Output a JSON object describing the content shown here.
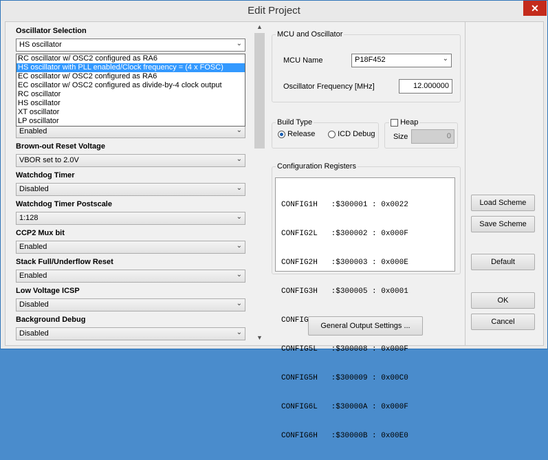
{
  "window": {
    "title": "Edit Project",
    "close_glyph": "✕"
  },
  "left": {
    "oscillator": {
      "label": "Oscillator Selection",
      "value": "HS oscillator",
      "options": [
        "RC oscillator w/ OSC2 configured as RA6",
        "HS oscillator with PLL enabled/Clock frequency = (4 x FOSC)",
        "EC oscillator w/ OSC2 configured as RA6",
        "EC oscillator w/ OSC2 configured as divide-by-4 clock output",
        "RC oscillator",
        "HS oscillator",
        "XT oscillator",
        "LP oscillator"
      ],
      "highlighted_index": 1
    },
    "hidden_combo_value": "Enabled",
    "settings": [
      {
        "label": "Brown-out Reset Voltage",
        "value": "VBOR set to 2.0V"
      },
      {
        "label": "Watchdog Timer",
        "value": "Disabled"
      },
      {
        "label": "Watchdog Timer Postscale",
        "value": "1:128"
      },
      {
        "label": "CCP2 Mux bit",
        "value": "Enabled"
      },
      {
        "label": "Stack Full/Underflow Reset",
        "value": "Enabled"
      },
      {
        "label": "Low Voltage ICSP",
        "value": "Disabled"
      },
      {
        "label": "Background Debug",
        "value": "Disabled"
      }
    ]
  },
  "mcu": {
    "group_title": "MCU and Oscillator",
    "name_label": "MCU Name",
    "name_value": "P18F452",
    "freq_label": "Oscillator Frequency [MHz]",
    "freq_value": "12.000000"
  },
  "build": {
    "group_title": "Build Type",
    "release_label": "Release",
    "icd_label": "ICD Debug",
    "selected": "Release"
  },
  "heap": {
    "label": "Heap",
    "size_label": "Size",
    "size_value": "0",
    "checked": false
  },
  "config": {
    "group_title": "Configuration Registers",
    "rows": [
      "CONFIG1H   :$300001 : 0x0022",
      "CONFIG2L   :$300002 : 0x000F",
      "CONFIG2H   :$300003 : 0x000E",
      "CONFIG3H   :$300005 : 0x0001",
      "CONFIG4L   :$300006 : 0x0081",
      "CONFIG5L   :$300008 : 0x000F",
      "CONFIG5H   :$300009 : 0x00C0",
      "CONFIG6L   :$30000A : 0x000F",
      "CONFIG6H   :$30000B : 0x00E0"
    ]
  },
  "buttons": {
    "general_output": "General Output Settings ...",
    "load_scheme": "Load Scheme",
    "save_scheme": "Save Scheme",
    "default": "Default",
    "ok": "OK",
    "cancel": "Cancel"
  },
  "scroll": {
    "up_glyph": "▲",
    "down_glyph": "▼"
  },
  "colors": {
    "selection": "#3399ff",
    "close": "#c42b1c"
  }
}
